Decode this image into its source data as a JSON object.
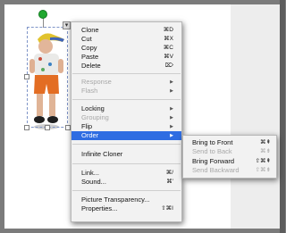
{
  "context_menu": {
    "items": [
      {
        "label": "Clone",
        "shortcut": "⌘D",
        "enabled": true
      },
      {
        "label": "Cut",
        "shortcut": "⌘X",
        "enabled": true
      },
      {
        "label": "Copy",
        "shortcut": "⌘C",
        "enabled": true
      },
      {
        "label": "Paste",
        "shortcut": "⌘V",
        "enabled": true
      },
      {
        "label": "Delete",
        "shortcut": "⌦",
        "enabled": true
      },
      {
        "label": "Response",
        "submenu": true,
        "enabled": false
      },
      {
        "label": "Flash",
        "submenu": true,
        "enabled": false
      },
      {
        "label": "Locking",
        "submenu": true,
        "enabled": true
      },
      {
        "label": "Grouping",
        "submenu": true,
        "enabled": false
      },
      {
        "label": "Flip",
        "submenu": true,
        "enabled": true
      },
      {
        "label": "Order",
        "submenu": true,
        "enabled": true,
        "highlighted": true
      },
      {
        "label": "Infinite Cloner",
        "enabled": true
      },
      {
        "label": "Link...",
        "shortcut": "⌘/",
        "enabled": true
      },
      {
        "label": "Sound...",
        "shortcut": "⌘'",
        "enabled": true
      },
      {
        "label": "Picture Transparency...",
        "enabled": true
      },
      {
        "label": "Properties...",
        "shortcut": "⇧⌘I",
        "enabled": true
      }
    ]
  },
  "order_submenu": {
    "items": [
      {
        "label": "Bring to Front",
        "shortcut": "⌘⇞",
        "enabled": true
      },
      {
        "label": "Send to Back",
        "shortcut": "⌘⇟",
        "enabled": false
      },
      {
        "label": "Bring Forward",
        "shortcut": "⇧⌘⇞",
        "enabled": true
      },
      {
        "label": "Send Backward",
        "shortcut": "⇧⌘⇟",
        "enabled": false
      }
    ]
  },
  "colors": {
    "highlight": "#2f6de2",
    "rotate_handle": "#20a830",
    "selection_border": "#7f95c8"
  },
  "icons": [
    "rotate-handle-icon",
    "submenu-arrow-icon",
    "dropdown-arrow-icon"
  ]
}
